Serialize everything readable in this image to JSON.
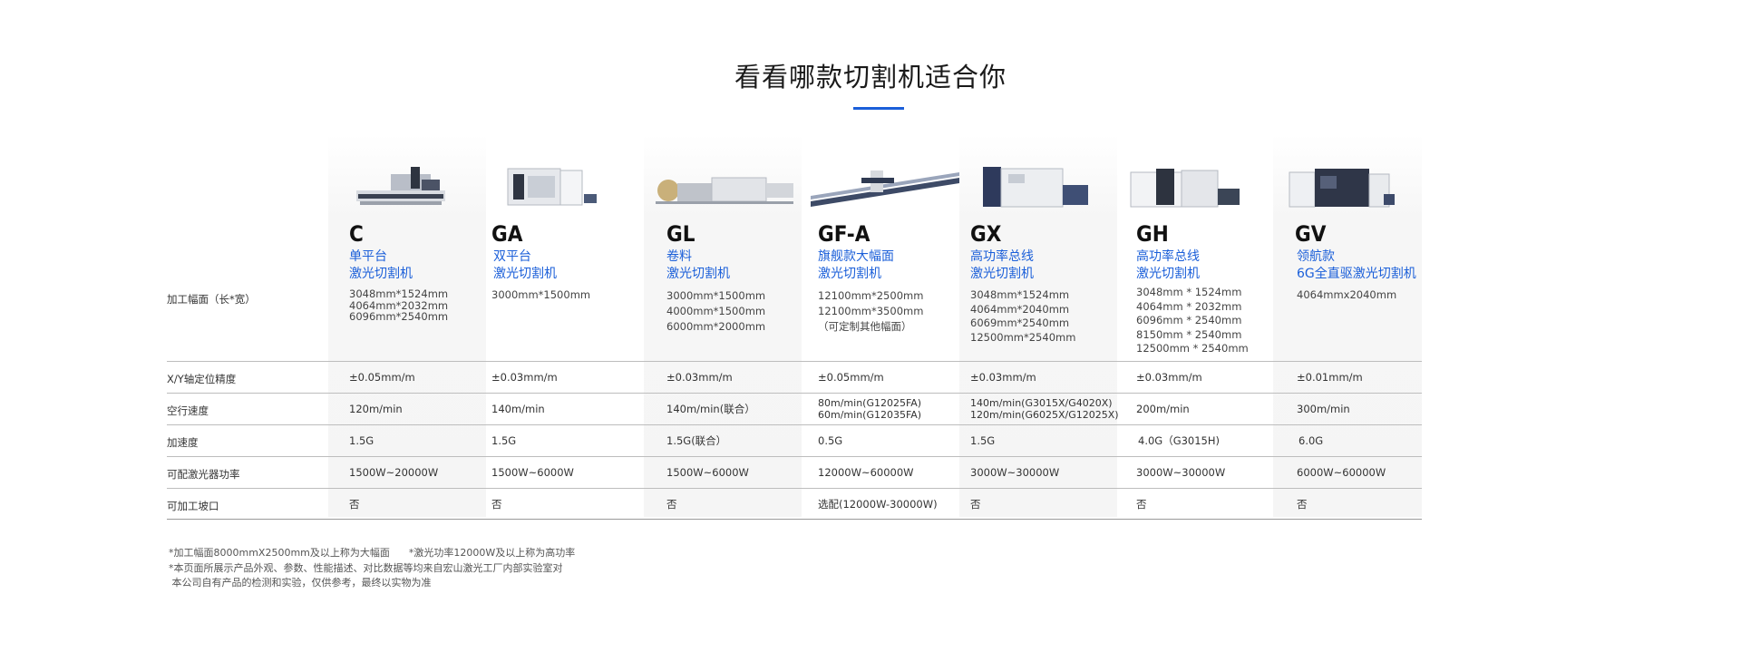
{
  "page": {
    "title": "看看哪款切割机适合你"
  },
  "colors": {
    "accent": "#1b5fd9",
    "text": "#333333",
    "band": "#f5f5f5"
  },
  "spec_labels": {
    "size": "加工幅面（长*宽）",
    "precision": "X/Y轴定位精度",
    "idle_speed": "空行速度",
    "acceleration": "加速度",
    "laser_power": "可配激光器功率",
    "bevel": "可加工坡口"
  },
  "models": [
    {
      "icon": "laser-cutter-open-bed-icon",
      "name": "C",
      "type_line1": "单平台",
      "type_line2": "激光切割机",
      "size": [
        "3048mm*1524mm",
        "4064mm*2032mm",
        "6096mm*2540mm"
      ],
      "precision": "±0.05mm/m",
      "idle_speed": [
        "120m/min"
      ],
      "acceleration": "1.5G",
      "laser_power": "1500W~20000W",
      "bevel": "否"
    },
    {
      "icon": "laser-cutter-enclosed-icon",
      "name": "GA",
      "type_line1": "双平台",
      "type_line2": "激光切割机",
      "size": [
        "3000mm*1500mm"
      ],
      "precision": "±0.03mm/m",
      "idle_speed": [
        "140m/min"
      ],
      "acceleration": "1.5G",
      "laser_power": "1500W~6000W",
      "bevel": "否"
    },
    {
      "icon": "coil-laser-cutter-icon",
      "name": "GL",
      "type_line1": "卷料",
      "type_line2": "激光切割机",
      "size": [
        "3000mm*1500mm",
        "4000mm*1500mm",
        "6000mm*2000mm"
      ],
      "precision": "±0.03mm/m",
      "idle_speed": [
        "140m/min(联合）"
      ],
      "acceleration": "1.5G(联合）",
      "laser_power": "1500W~6000W",
      "bevel": "否"
    },
    {
      "icon": "gantry-laser-cutter-icon",
      "name": "GF-A",
      "type_line1": "旗舰款大幅面",
      "type_line2": "激光切割机",
      "size": [
        "12100mm*2500mm",
        "12100mm*3500mm",
        "（可定制其他幅面）"
      ],
      "precision": "±0.05mm/m",
      "idle_speed": [
        "80m/min(G12025FA)",
        "60m/min(G12035FA)"
      ],
      "acceleration": "0.5G",
      "laser_power": "12000W~60000W",
      "bevel": "选配(12000W-30000W)"
    },
    {
      "icon": "high-power-laser-cutter-icon",
      "name": "GX",
      "type_line1": "高功率总线",
      "type_line2": "激光切割机",
      "size": [
        "3048mm*1524mm",
        "4064mm*2040mm",
        "6069mm*2540mm",
        "12500mm*2540mm"
      ],
      "precision": "±0.03mm/m",
      "idle_speed": [
        "140m/min(G3015X/G4020X)",
        "120m/min(G6025X/G12025X)"
      ],
      "acceleration": "1.5G",
      "laser_power": "3000W~30000W",
      "bevel": "否"
    },
    {
      "icon": "high-power-laser-cutter-icon",
      "name": "GH",
      "type_line1": "高功率总线",
      "type_line2": "激光切割机",
      "size": [
        "3048mm * 1524mm",
        "4064mm * 2032mm",
        "6096mm * 2540mm",
        "8150mm * 2540mm",
        "12500mm * 2540mm"
      ],
      "precision": "±0.03mm/m",
      "idle_speed": [
        "200m/min"
      ],
      "acceleration": "4.0G（G3015H)",
      "laser_power": "3000W~30000W",
      "bevel": "否"
    },
    {
      "icon": "flagship-laser-cutter-icon",
      "name": "GV",
      "type_line1": "领航款",
      "type_line2": "6G全直驱激光切割机",
      "size": [
        "4064mmx2040mm"
      ],
      "precision": "±0.01mm/m",
      "idle_speed": [
        "300m/min"
      ],
      "acceleration": "6.0G",
      "laser_power": "6000W~60000W",
      "bevel": "否"
    }
  ],
  "notes": [
    "*加工幅面8000mmX2500mm及以上称为大幅面      *激光功率12000W及以上称为高功率",
    "*本页面所展示产品外观、参数、性能描述、对比数据等均来自宏山激光工厂内部实验室对",
    " 本公司自有产品的检测和实验，仅供参考，最终以实物为准"
  ]
}
